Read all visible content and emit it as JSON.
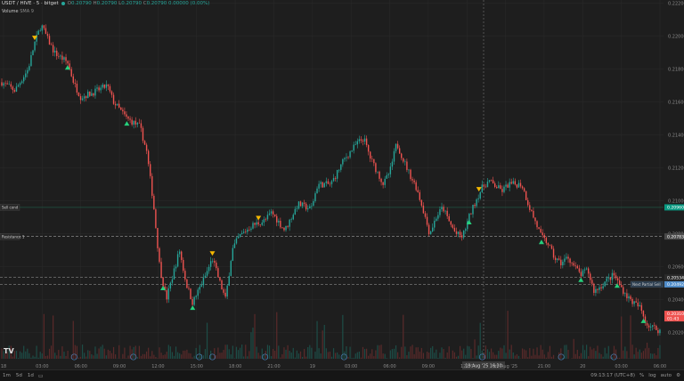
{
  "header": {
    "symbol": "USDT / HIVE · 5 · bitget",
    "ohlc": [
      {
        "k": "O",
        "v": "0.20790"
      },
      {
        "k": "H",
        "v": "0.20790"
      },
      {
        "k": "L",
        "v": "0.20790"
      },
      {
        "k": "C",
        "v": "0.20790 0.00000 (0.00%)"
      }
    ]
  },
  "volume": {
    "label": "Volume",
    "ma": "SMA 9"
  },
  "colors": {
    "up": "#26a69a",
    "down": "#ef5350",
    "bg": "#1e1e1e",
    "grid": "#2b2b2b",
    "axis": "#8a8a8a",
    "accent_green": "#089981",
    "accent_blue": "#2962ff"
  },
  "chart_data": {
    "type": "candlestick",
    "price_ticks": [
      "0.22200",
      "0.22000",
      "0.21800",
      "0.21600",
      "0.21400",
      "0.21200",
      "0.21000",
      "0.20800",
      "0.20600",
      "0.20400",
      "0.20200"
    ],
    "time_ticks": [
      "18",
      "03:00",
      "06:00",
      "09:00",
      "12:00",
      "15:00",
      "18:00",
      "21:00",
      "19",
      "03:00",
      "06:00",
      "09:00",
      "12:00",
      "19 Aug '25",
      "21:00",
      "20",
      "03:00",
      "06:00"
    ],
    "ylim": [
      0.2004,
      0.2222
    ],
    "price_path": [
      [
        0,
        0.2172
      ],
      [
        0.02,
        0.2167
      ],
      [
        0.04,
        0.218
      ],
      [
        0.05,
        0.2196
      ],
      [
        0.06,
        0.2207
      ],
      [
        0.07,
        0.2198
      ],
      [
        0.08,
        0.219
      ],
      [
        0.1,
        0.2184
      ],
      [
        0.11,
        0.2171
      ],
      [
        0.12,
        0.2163
      ],
      [
        0.14,
        0.2166
      ],
      [
        0.16,
        0.217
      ],
      [
        0.17,
        0.216
      ],
      [
        0.19,
        0.215
      ],
      [
        0.21,
        0.2145
      ],
      [
        0.22,
        0.213
      ],
      [
        0.23,
        0.21
      ],
      [
        0.24,
        0.206
      ],
      [
        0.25,
        0.204
      ],
      [
        0.26,
        0.2055
      ],
      [
        0.27,
        0.207
      ],
      [
        0.28,
        0.205
      ],
      [
        0.29,
        0.2038
      ],
      [
        0.31,
        0.2055
      ],
      [
        0.32,
        0.2065
      ],
      [
        0.33,
        0.2052
      ],
      [
        0.34,
        0.204
      ],
      [
        0.35,
        0.207
      ],
      [
        0.36,
        0.2078
      ],
      [
        0.38,
        0.2085
      ],
      [
        0.4,
        0.2088
      ],
      [
        0.41,
        0.2093
      ],
      [
        0.43,
        0.2082
      ],
      [
        0.45,
        0.2098
      ],
      [
        0.47,
        0.2095
      ],
      [
        0.48,
        0.211
      ],
      [
        0.5,
        0.211
      ],
      [
        0.52,
        0.2125
      ],
      [
        0.54,
        0.2135
      ],
      [
        0.55,
        0.2138
      ],
      [
        0.56,
        0.2126
      ],
      [
        0.58,
        0.211
      ],
      [
        0.59,
        0.2118
      ],
      [
        0.6,
        0.2135
      ],
      [
        0.61,
        0.2125
      ],
      [
        0.62,
        0.2116
      ],
      [
        0.63,
        0.2108
      ],
      [
        0.64,
        0.2095
      ],
      [
        0.65,
        0.208
      ],
      [
        0.66,
        0.209
      ],
      [
        0.67,
        0.2096
      ],
      [
        0.68,
        0.2087
      ],
      [
        0.69,
        0.208
      ],
      [
        0.7,
        0.2078
      ],
      [
        0.71,
        0.209
      ],
      [
        0.72,
        0.21
      ],
      [
        0.73,
        0.2108
      ],
      [
        0.74,
        0.2112
      ],
      [
        0.76,
        0.2106
      ],
      [
        0.77,
        0.211
      ],
      [
        0.79,
        0.211
      ],
      [
        0.8,
        0.2098
      ],
      [
        0.81,
        0.2088
      ],
      [
        0.82,
        0.2078
      ],
      [
        0.83,
        0.2074
      ],
      [
        0.84,
        0.2065
      ],
      [
        0.85,
        0.2062
      ],
      [
        0.86,
        0.2066
      ],
      [
        0.87,
        0.206
      ],
      [
        0.88,
        0.2055
      ],
      [
        0.89,
        0.2058
      ],
      [
        0.9,
        0.2045
      ],
      [
        0.91,
        0.2048
      ],
      [
        0.92,
        0.2052
      ],
      [
        0.93,
        0.2055
      ],
      [
        0.94,
        0.2048
      ],
      [
        0.95,
        0.2042
      ],
      [
        0.96,
        0.2038
      ],
      [
        0.97,
        0.2035
      ],
      [
        0.98,
        0.2025
      ],
      [
        1.0,
        0.2021
      ]
    ],
    "signals": [
      {
        "t": 0.05,
        "kind": "sell"
      },
      {
        "t": 0.1,
        "kind": "buy"
      },
      {
        "t": 0.19,
        "kind": "buy"
      },
      {
        "t": 0.245,
        "kind": "buy"
      },
      {
        "t": 0.29,
        "kind": "buy"
      },
      {
        "t": 0.32,
        "kind": "sell"
      },
      {
        "t": 0.39,
        "kind": "sell"
      },
      {
        "t": 0.71,
        "kind": "buy"
      },
      {
        "t": 0.725,
        "kind": "sell"
      },
      {
        "t": 0.82,
        "kind": "buy"
      },
      {
        "t": 0.88,
        "kind": "buy"
      },
      {
        "t": 0.935,
        "kind": "buy"
      },
      {
        "t": 0.975,
        "kind": "buy"
      }
    ],
    "hlines": [
      {
        "price": 0.2096,
        "style": "solid",
        "color": "#1f5f4a",
        "label": "Sell cond",
        "price_label": "0.20960",
        "bg": "#089981"
      },
      {
        "price": 0.20783,
        "style": "dashed",
        "color": "#888888",
        "label": "Resistance 1",
        "price_label": "0.20783",
        "bg": "#4a4a4a"
      },
      {
        "price": 0.20534,
        "style": "dashed",
        "color": "#888888",
        "label": "",
        "price_label": "0.20534",
        "bg": "#2a2a2a"
      },
      {
        "price": 0.20492,
        "style": "dashed",
        "color": "#888888",
        "label": "Next Partial Sell",
        "price_label": "0.20492",
        "bg": "#4f8cc9"
      }
    ],
    "last_price": {
      "value": "0.20310",
      "countdown": "01:43",
      "bg": "#ef5350"
    },
    "crosshair_x_label": "19 Aug '25   16:30"
  },
  "bottom_bar": {
    "timeframes": [
      "1m",
      "5d",
      "1d"
    ],
    "time": "09:13:17 (UTC+8)",
    "options": [
      "%",
      "log",
      "auto"
    ]
  },
  "logo": "TV"
}
